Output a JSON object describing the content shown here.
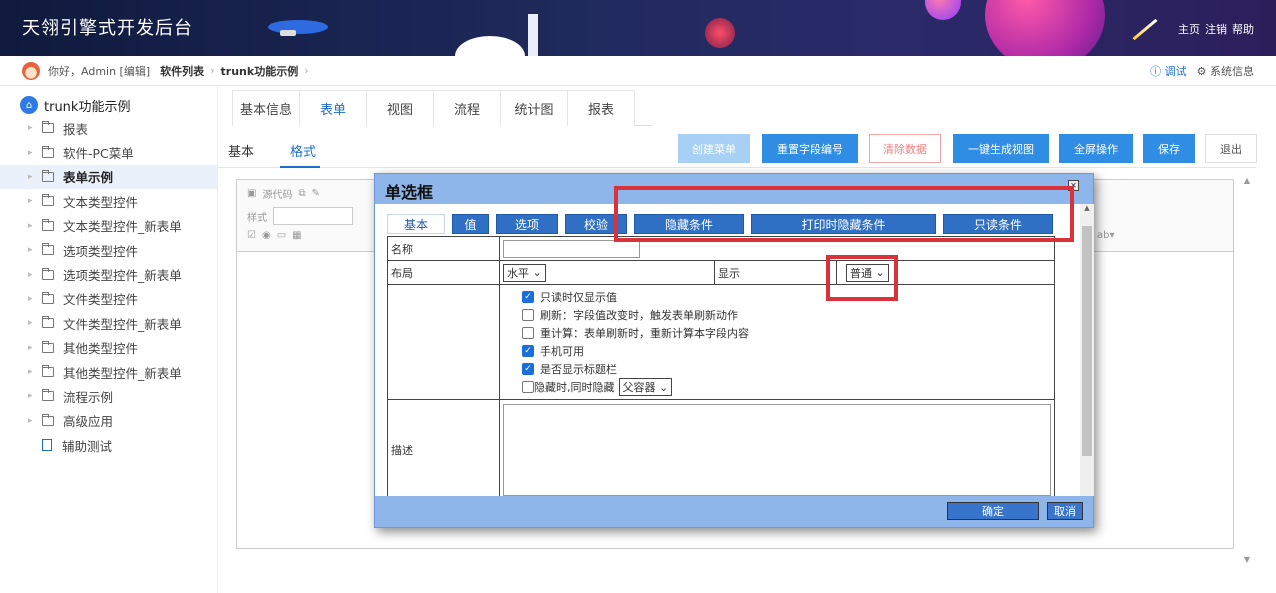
{
  "header": {
    "title": "天翎引擎式开发后台",
    "links": [
      "主页",
      "注销",
      "帮助"
    ]
  },
  "breadcrumb": {
    "greeting": "你好，Admin [编辑]",
    "items": [
      "软件列表",
      "trunk功能示例"
    ],
    "right_debug": "调试",
    "right_sysinfo": "系统信息"
  },
  "sidebar": {
    "root": "trunk功能示例",
    "items": [
      {
        "label": "报表",
        "active": false
      },
      {
        "label": "软件-PC菜单",
        "active": false
      },
      {
        "label": "表单示例",
        "active": true
      },
      {
        "label": "文本类型控件",
        "active": false
      },
      {
        "label": "文本类型控件_新表单",
        "active": false
      },
      {
        "label": "选项类型控件",
        "active": false
      },
      {
        "label": "选项类型控件_新表单",
        "active": false
      },
      {
        "label": "文件类型控件",
        "active": false
      },
      {
        "label": "文件类型控件_新表单",
        "active": false
      },
      {
        "label": "其他类型控件",
        "active": false
      },
      {
        "label": "其他类型控件_新表单",
        "active": false
      },
      {
        "label": "流程示例",
        "active": false
      },
      {
        "label": "高级应用",
        "active": false
      }
    ],
    "doc_item": "辅助测试"
  },
  "main": {
    "tabs": [
      "基本信息",
      "表单",
      "视图",
      "流程",
      "统计图",
      "报表"
    ],
    "active_tab": "表单",
    "subtabs": [
      "基本",
      "格式"
    ],
    "buttons": {
      "create_menu": "创建菜单",
      "reset_field": "重置字段编号",
      "clear_data": "清除数据",
      "gen_view": "一键生成视图",
      "fullscreen": "全屏操作",
      "save": "保存",
      "exit": "退出"
    },
    "toolbar": {
      "source": "源代码",
      "style": "样式"
    }
  },
  "dialog": {
    "title": "单选框",
    "tabs": [
      "基本",
      "值",
      "选项",
      "校验",
      "隐藏条件",
      "打印时隐藏条件",
      "只读条件"
    ],
    "fields": {
      "name_label": "名称",
      "name_value": "",
      "layout_label": "布局",
      "layout_value": "水平",
      "display_label": "显示",
      "display_value": "普通",
      "desc_label": "描述"
    },
    "checks": [
      {
        "label": "只读时仅显示值",
        "checked": true
      },
      {
        "label": "刷新：字段值改变时，触发表单刷新动作",
        "checked": false
      },
      {
        "label": "重计算：表单刷新时，重新计算本字段内容",
        "checked": false
      },
      {
        "label": "手机可用",
        "checked": true
      },
      {
        "label": "是否显示标题栏",
        "checked": true
      }
    ],
    "hide_check": {
      "label": "隐藏时,同时隐藏",
      "checked": false,
      "select": "父容器"
    },
    "ok": "确定",
    "cancel": "取消"
  }
}
